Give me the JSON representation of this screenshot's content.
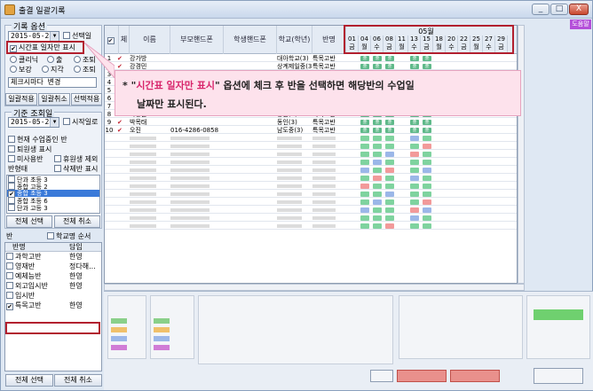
{
  "window": {
    "title": "출결 일괄기록",
    "help": "도움말",
    "min": "_",
    "max": "□",
    "close": "X"
  },
  "record_options": {
    "title": "기록 옵션",
    "date": "2015-05-28",
    "select_day_label": "선택일",
    "timetable_only_label": "시간표 일자만 표시",
    "radios_row1": [
      "클리닉",
      "출",
      "조퇴"
    ],
    "radios_row2": [
      "보강",
      "지각",
      "조퇴"
    ],
    "check_cancel_label": "체크시마다 변경",
    "buttons": [
      "일괄적용",
      "일괄취소",
      "선택적용"
    ]
  },
  "base_date": {
    "title": "기준 조회일",
    "date": "2015-05-28",
    "start_day_label": "시작일로",
    "options": [
      "현재 수업중인 반",
      "퇴원생 표시",
      "미사용반",
      "휴원생 제외"
    ],
    "class_state_label": "반형태",
    "cancel_state_label": "삭제반 표시",
    "class_list": [
      "단과 초등 3",
      "종합 고등 2",
      "종합 초등 3",
      "종합 초등 6",
      "단과 고등 3",
      "단과 BASIC 1",
      "응시 인터넷 0",
      "응시 인터넷 0"
    ],
    "buttons": [
      "전체 선택",
      "전체 취소"
    ]
  },
  "class_panel": {
    "title": "반",
    "school_order_label": "학교명 순서",
    "headers": [
      "반명",
      "담임"
    ],
    "rows": [
      {
        "name": "과학고반",
        "teacher": "한영"
      },
      {
        "name": "영재반",
        "teacher": "정다해..."
      },
      {
        "name": "예체능반",
        "teacher": "한영"
      },
      {
        "name": "외고입시반",
        "teacher": "한영"
      },
      {
        "name": "입시반",
        "teacher": ""
      },
      {
        "name": "특목고반",
        "teacher": "한영"
      }
    ],
    "buttons": [
      "전체 선택",
      "전체 취소"
    ]
  },
  "grid": {
    "headers": [
      "체",
      "이름",
      "부모핸드폰",
      "학생핸드폰",
      "학교(학년)",
      "반명"
    ],
    "month": "05월",
    "dates": [
      {
        "d": "01",
        "w": "금"
      },
      {
        "d": "04",
        "w": "월"
      },
      {
        "d": "06",
        "w": "수"
      },
      {
        "d": "08",
        "w": "금"
      },
      {
        "d": "11",
        "w": "월"
      },
      {
        "d": "13",
        "w": "수"
      },
      {
        "d": "15",
        "w": "금"
      },
      {
        "d": "18",
        "w": "월"
      },
      {
        "d": "20",
        "w": "수"
      },
      {
        "d": "22",
        "w": "금"
      },
      {
        "d": "25",
        "w": "월"
      },
      {
        "d": "27",
        "w": "수"
      },
      {
        "d": "29",
        "w": "금"
      }
    ],
    "rows": [
      {
        "no": "1",
        "name": "강가방",
        "parent": "",
        "student": "",
        "school": "대아학교(3)",
        "class": "특목고반"
      },
      {
        "no": "2",
        "name": "강경민",
        "parent": "",
        "student": "",
        "school": "상계제일중(3)",
        "class": "특목고반"
      },
      {
        "no": "3",
        "name": "",
        "parent": "",
        "student": "",
        "school": "",
        "class": ""
      },
      {
        "no": "4",
        "name": "",
        "parent": "",
        "student": "",
        "school": "",
        "class": ""
      },
      {
        "no": "5",
        "name": "",
        "parent": "",
        "student": "",
        "school": "",
        "class": ""
      },
      {
        "no": "6",
        "name": "",
        "parent": "",
        "student": "",
        "school": "",
        "class": ""
      },
      {
        "no": "7",
        "name": "",
        "parent": "",
        "student": "",
        "school": "",
        "class": ""
      },
      {
        "no": "8",
        "name": "박상원",
        "parent": "",
        "student": "",
        "school": "상원(3)",
        "class": "특목고반"
      },
      {
        "no": "9",
        "name": "박목태",
        "parent": "",
        "student": "",
        "school": "동인(3)",
        "class": "특목고반"
      },
      {
        "no": "10",
        "name": "오진",
        "parent": "016-4286-0858",
        "student": "",
        "school": "남도중(3)",
        "class": "특목고반"
      }
    ],
    "att_mark": "출"
  },
  "callout": {
    "line1_prefix": "* \"",
    "line1_quote": "시간표 일자만 표시",
    "line1_suffix": "\" 옵션에 체크 후 반을 선택하면 해당반의 수업일",
    "line2": "날짜만 표시된다."
  },
  "colors": {
    "att": "#5fb98a",
    "accent_red": "#b2202f",
    "highlight": "#d8256c"
  }
}
